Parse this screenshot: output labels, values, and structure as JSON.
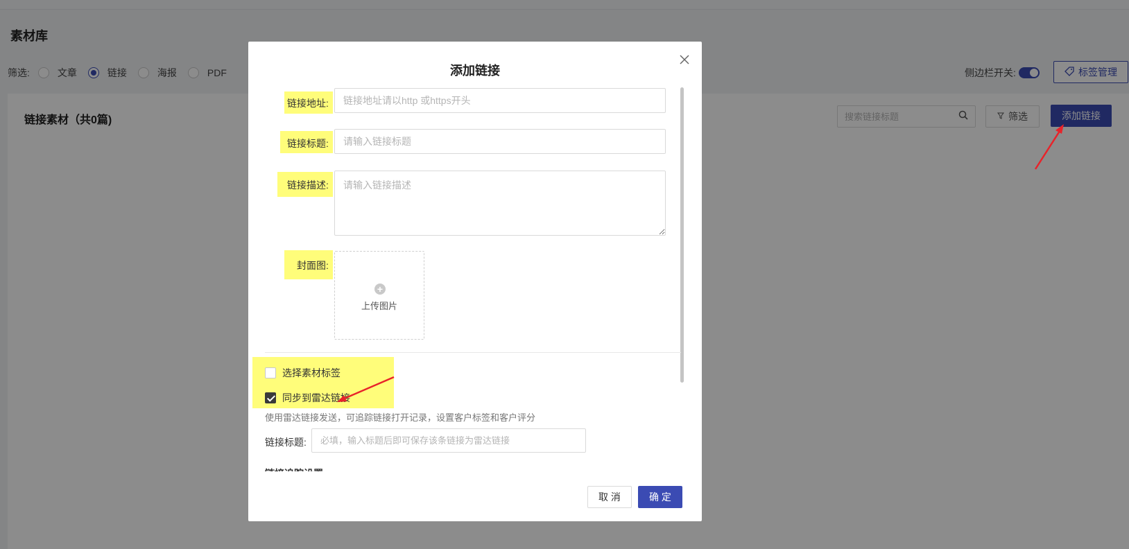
{
  "page": {
    "title": "素材库",
    "filter_label": "筛选:",
    "filter_options": [
      "文章",
      "链接",
      "海报",
      "PDF"
    ],
    "selected_filter": "链接",
    "sidebar_toggle_label": "侧边栏开关:",
    "sidebar_toggle_on": true,
    "tag_manage_button": "标签管理"
  },
  "content": {
    "title": "链接素材（共0篇)",
    "search_placeholder": "搜索链接标题",
    "filter_button": "筛选",
    "add_link_button": "添加链接"
  },
  "modal": {
    "title": "添加链接",
    "fields": {
      "url_label": "链接地址:",
      "url_placeholder": "链接地址请以http 或https开头",
      "title_label": "链接标题:",
      "title_placeholder": "请输入链接标题",
      "desc_label": "链接描述:",
      "desc_placeholder": "请输入链接描述",
      "cover_label": "封面图:",
      "upload_text": "上传图片"
    },
    "tag_checkbox": {
      "label": "选择素材标签",
      "checked": false
    },
    "radar_checkbox": {
      "label": "同步到雷达链接",
      "checked": true
    },
    "radar_desc": "使用雷达链接发送，可追踪链接打开记录，设置客户标签和客户评分",
    "radar_title_label": "链接标题:",
    "radar_title_placeholder": "必填，输入标题后即可保存该条链接为雷达链接",
    "radar_section_cut": "链接追踪设置",
    "cancel_button": "取 消",
    "ok_button": "确 定"
  },
  "colors": {
    "primary": "#3b4bb3",
    "highlight": "#fffd7a",
    "annotation_arrow": "#e8232a"
  }
}
